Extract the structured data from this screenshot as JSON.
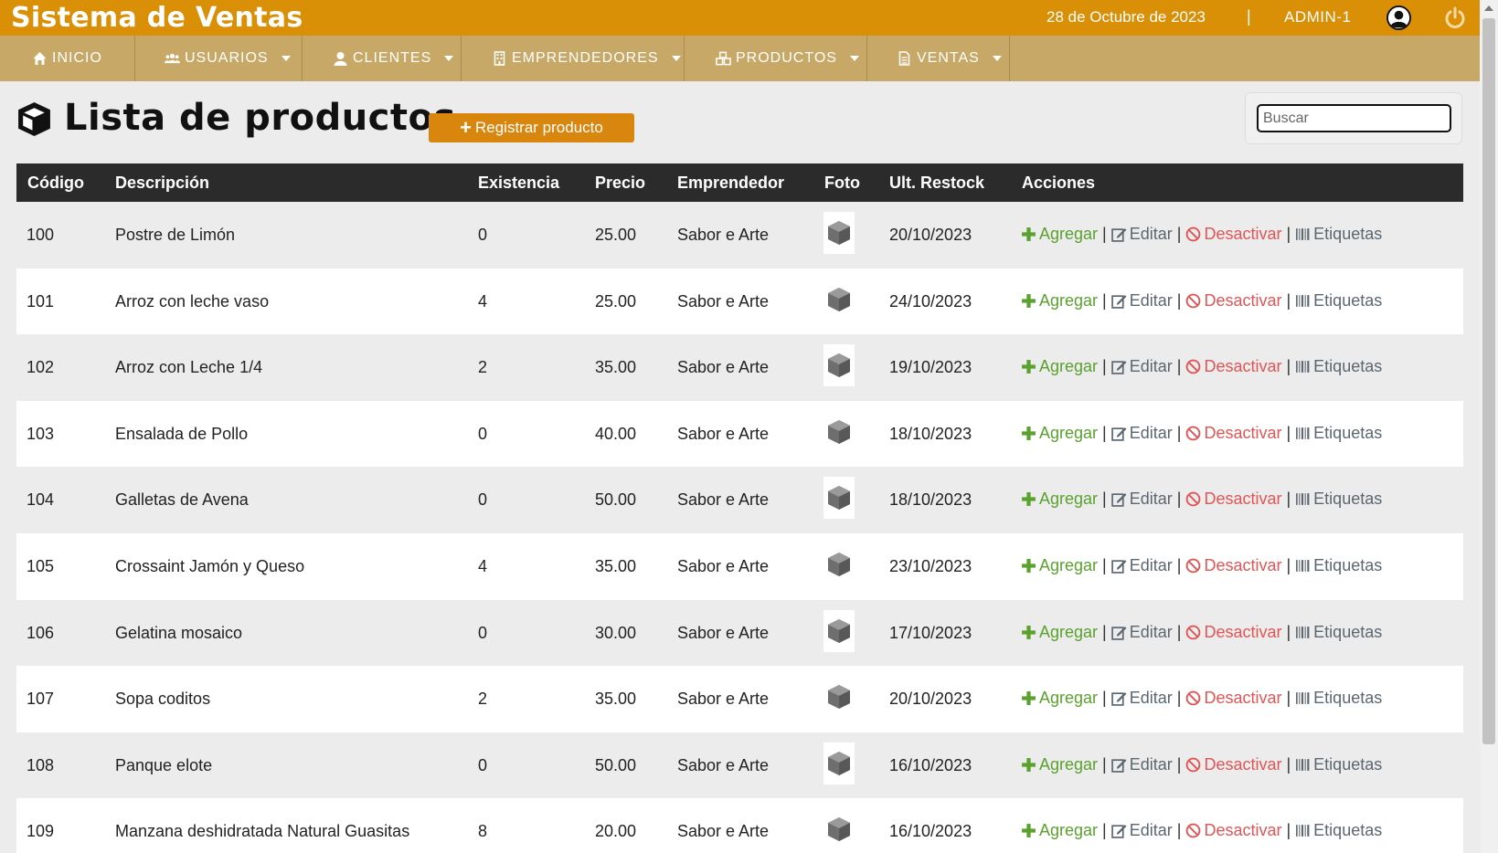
{
  "header": {
    "title": "Sistema de Ventas",
    "date": "28 de Octubre de 2023",
    "separator": "|",
    "user": "ADMIN-1",
    "brand_color": "#d98f06",
    "nav_color": "#c8a867"
  },
  "nav": {
    "items": [
      {
        "label": "INICIO",
        "icon": "home-icon",
        "dropdown": false
      },
      {
        "label": "USUARIOS",
        "icon": "users-icon",
        "dropdown": true
      },
      {
        "label": "CLIENTES",
        "icon": "user-icon",
        "dropdown": true
      },
      {
        "label": "EMPRENDEDORES",
        "icon": "building-icon",
        "dropdown": true
      },
      {
        "label": "PRODUCTOS",
        "icon": "cubes-icon",
        "dropdown": true
      },
      {
        "label": "VENTAS",
        "icon": "file-icon",
        "dropdown": true
      }
    ]
  },
  "page": {
    "title": "Lista de productos",
    "register_label": "Registrar producto",
    "search_placeholder": "Buscar"
  },
  "table": {
    "columns": [
      "Código",
      "Descripción",
      "Existencia",
      "Precio",
      "Emprendedor",
      "Foto",
      "Ult. Restock",
      "Acciones"
    ],
    "actions": {
      "add": "Agregar",
      "edit": "Editar",
      "deactivate": "Desactivar",
      "labels": "Etiquetas",
      "separator": "|"
    },
    "rows": [
      {
        "code": "100",
        "desc": "Postre de Limón",
        "stock": "0",
        "price": "25.00",
        "vendor": "Sabor e Arte",
        "restock": "20/10/2023"
      },
      {
        "code": "101",
        "desc": "Arroz con leche vaso",
        "stock": "4",
        "price": "25.00",
        "vendor": "Sabor e Arte",
        "restock": "24/10/2023"
      },
      {
        "code": "102",
        "desc": "Arroz con Leche 1/4",
        "stock": "2",
        "price": "35.00",
        "vendor": "Sabor e Arte",
        "restock": "19/10/2023"
      },
      {
        "code": "103",
        "desc": "Ensalada de Pollo",
        "stock": "0",
        "price": "40.00",
        "vendor": "Sabor e Arte",
        "restock": "18/10/2023"
      },
      {
        "code": "104",
        "desc": "Galletas de Avena",
        "stock": "0",
        "price": "50.00",
        "vendor": "Sabor e Arte",
        "restock": "18/10/2023"
      },
      {
        "code": "105",
        "desc": "Crossaint Jamón y Queso",
        "stock": "4",
        "price": "35.00",
        "vendor": "Sabor e Arte",
        "restock": "23/10/2023"
      },
      {
        "code": "106",
        "desc": "Gelatina mosaico",
        "stock": "0",
        "price": "30.00",
        "vendor": "Sabor e Arte",
        "restock": "17/10/2023"
      },
      {
        "code": "107",
        "desc": "Sopa coditos",
        "stock": "2",
        "price": "35.00",
        "vendor": "Sabor e Arte",
        "restock": "20/10/2023"
      },
      {
        "code": "108",
        "desc": "Panque elote",
        "stock": "0",
        "price": "50.00",
        "vendor": "Sabor e Arte",
        "restock": "16/10/2023"
      },
      {
        "code": "109",
        "desc": "Manzana deshidratada Natural Guasitas",
        "stock": "8",
        "price": "20.00",
        "vendor": "Sabor e Arte",
        "restock": "16/10/2023"
      }
    ]
  }
}
